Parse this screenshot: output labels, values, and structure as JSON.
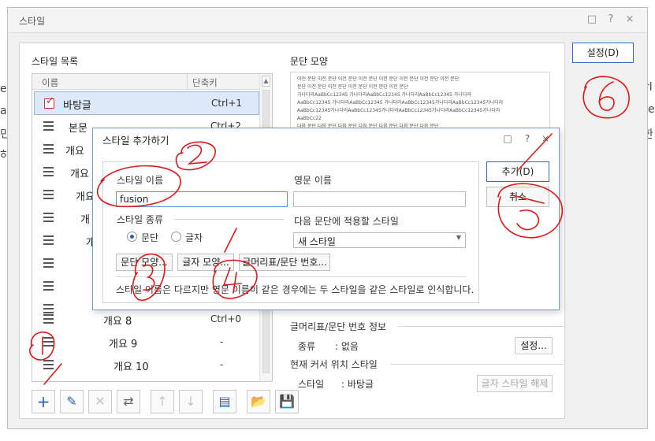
{
  "background": {
    "left_fragments": [
      "e",
      "a",
      "민",
      "하"
    ],
    "right_fragments": [
      "rl",
      "e",
      "한"
    ]
  },
  "window": {
    "title": "스타일",
    "controls": [
      "□",
      "?",
      "×"
    ]
  },
  "style_list": {
    "label": "스타일 목록",
    "header_name": "이름",
    "header_key": "단축키",
    "items": [
      {
        "name": "바탕글",
        "key": "Ctrl+1"
      },
      {
        "name": "본문",
        "key": "Ctrl+2"
      },
      {
        "name": "개요",
        "key": ""
      },
      {
        "name": "개요",
        "key": ""
      },
      {
        "name": "개요",
        "key": ""
      },
      {
        "name": "개",
        "key": ""
      },
      {
        "name": "개",
        "key": ""
      },
      {
        "name": "개요 8",
        "key": "Ctrl+0"
      },
      {
        "name": "개요 9",
        "key": "-"
      },
      {
        "name": "개요 10",
        "key": "-"
      }
    ]
  },
  "toolbar": {
    "add": "+",
    "edit": "✎",
    "delete": "✕",
    "replace": "⇄",
    "up": "↑",
    "down": "↓",
    "import": "▤",
    "open": "📂",
    "save": "💾"
  },
  "paragraph": {
    "label": "문단 모양",
    "preview_lines": [
      "이전 문단 이전 문단 이전 문단 이전 문단 이전 문단 이전 문단 이전 문단 이전 문단",
      "문단 이전 문단 이전 문단 이전 문단 이전 문단 이전 문단",
      "가나다라AaBbCc12345   가나다라AaBbCc12345   가나다라AaBbCc12345   가나다라",
      "AaBbCc12345 가나다라AaBbCc12345 가나다라AaBbCc12345가나다라AaBbCc12345가나다라",
      "AaBbCc12345가나다라AaBbCc12345가나다라AaBbCc12345가나다라AaBbCc12345가나다라",
      "AaBbCc22",
      "다음 문단 다음 문단 다음 문단 다음 문단 다음 문단 다음 문단 다음 문단"
    ]
  },
  "numbering": {
    "label": "글머리표/문단 번호 정보",
    "kind_label": "종류",
    "kind_value": ": 없음",
    "settings_button": "설정..."
  },
  "cursor_style": {
    "label": "현재 커서 위치 스타일",
    "style_label": "스타일",
    "style_value": ": 바탕글",
    "clear_button": "글자 스타일 해제"
  },
  "settings_button": "설정(D)",
  "add_dialog": {
    "title": "스타일 추가하기",
    "controls": [
      "□",
      "?",
      "×"
    ],
    "name_label": "스타일 이름",
    "name_value": "fusion",
    "english_label": "영문 이름",
    "english_value": "",
    "type_label": "스타일 종류",
    "type_paragraph": "문단",
    "type_char": "글자",
    "next_label": "다음 문단에 적용할 스타일",
    "next_value": "새 스타일",
    "btn_paragraph": "문단 모양...",
    "btn_char": "글자 모양...",
    "btn_numbering": "글머리표/문단 번호...",
    "note": "스타일 이름은 다르지만 영문 이름이 같은 경우에는 두 스타일을 같은 스타일로 인식합니다.",
    "add_button": "추가(D)",
    "cancel_button": "취소"
  },
  "annotations": [
    "1",
    "2",
    "3",
    "4",
    "5",
    "6"
  ]
}
